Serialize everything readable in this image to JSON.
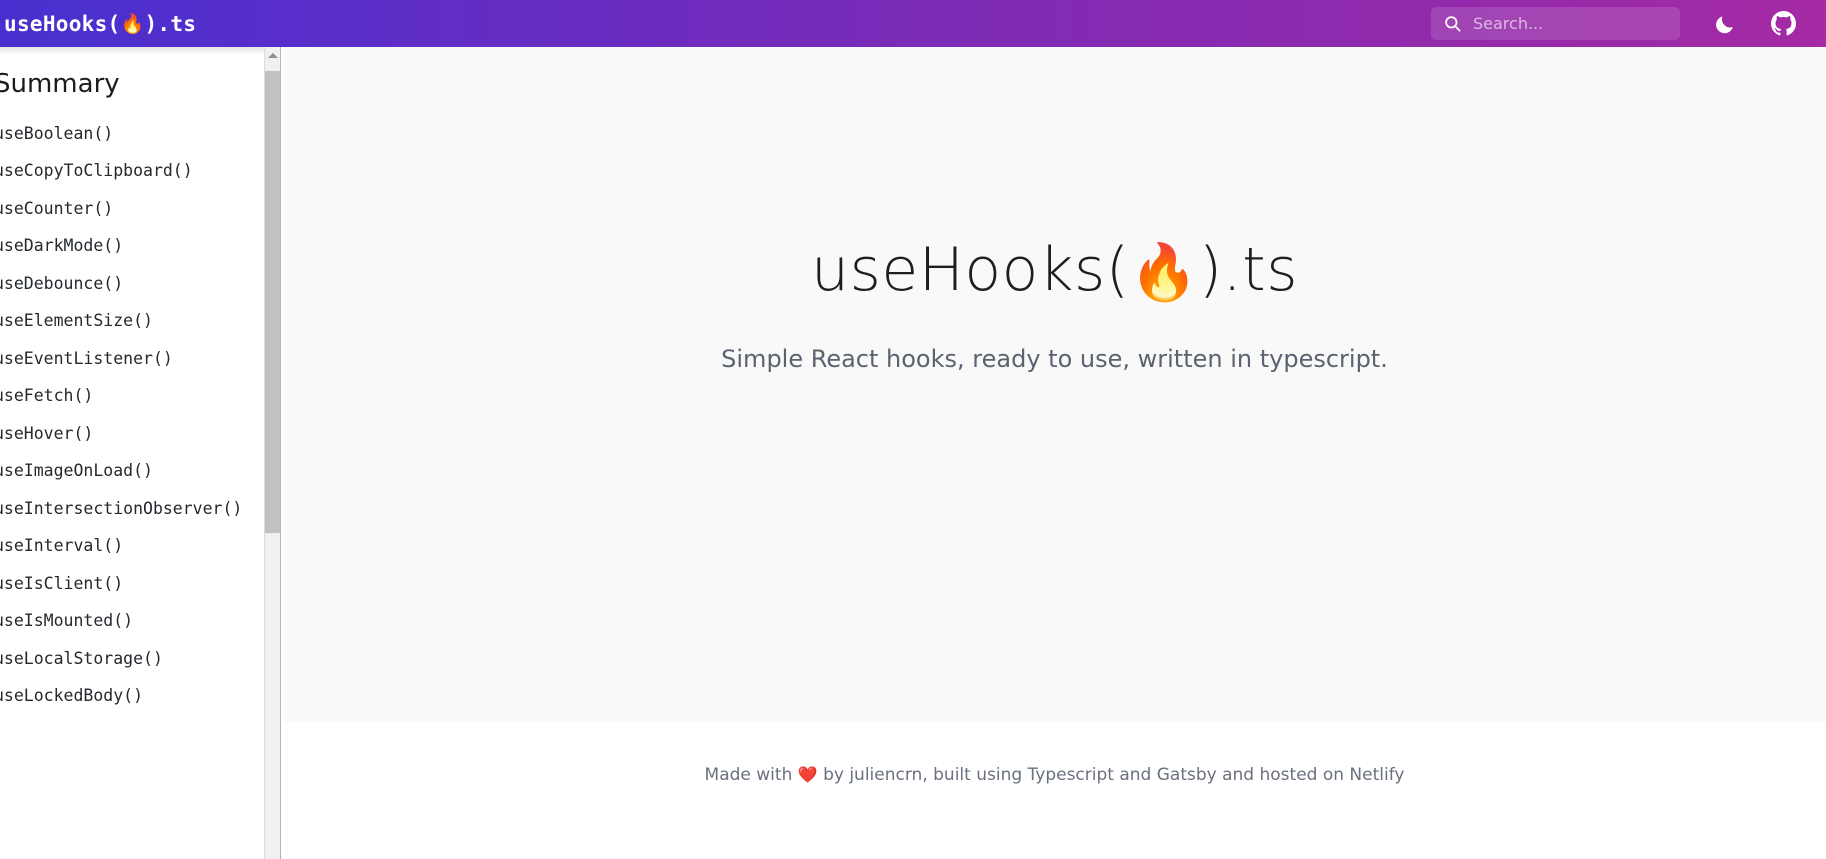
{
  "header": {
    "title_text": "useHooks(",
    "title_emoji": "🔥",
    "title_suffix": ").ts",
    "search": {
      "placeholder": "Search...",
      "value": "",
      "icon": "search-icon"
    },
    "dark_mode_icon": "moon-icon",
    "github_icon": "github-icon",
    "gradient_start": "#4730cf",
    "gradient_end": "#a52aa4"
  },
  "sidebar": {
    "heading": "Summary",
    "items": [
      {
        "label": "useBoolean()"
      },
      {
        "label": "useCopyToClipboard()"
      },
      {
        "label": "useCounter()"
      },
      {
        "label": "useDarkMode()"
      },
      {
        "label": "useDebounce()"
      },
      {
        "label": "useElementSize()"
      },
      {
        "label": "useEventListener()"
      },
      {
        "label": "useFetch()"
      },
      {
        "label": "useHover()"
      },
      {
        "label": "useImageOnLoad()"
      },
      {
        "label": "useIntersectionObserver()"
      },
      {
        "label": "useInterval()"
      },
      {
        "label": "useIsClient()"
      },
      {
        "label": "useIsMounted()"
      },
      {
        "label": "useLocalStorage()"
      },
      {
        "label": "useLockedBody()"
      }
    ],
    "scrollbar": {
      "up_arrow_icon": "chevron-up-icon"
    }
  },
  "main": {
    "hero": {
      "title_text": "useHooks(",
      "title_emoji": "🔥",
      "title_suffix": ").ts",
      "subtitle": "Simple React hooks, ready to use, written in typescript."
    },
    "background_color": "#f9f9f9"
  },
  "footer": {
    "prefix": "Made with ",
    "heart": "❤️",
    "suffix": " by juliencrn, built using Typescript and Gatsby and hosted on Netlify"
  }
}
